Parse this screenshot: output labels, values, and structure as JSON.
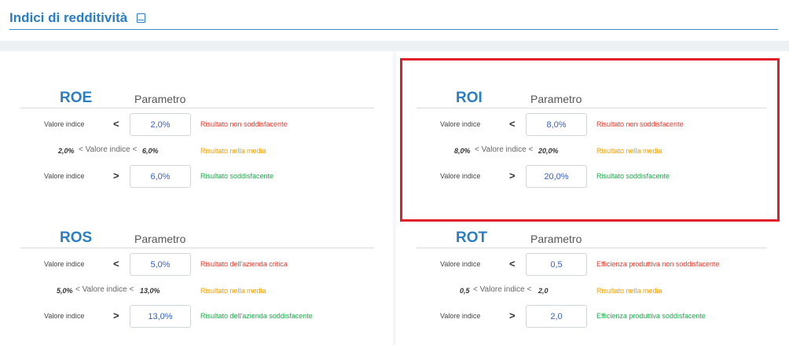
{
  "page": {
    "title": "Indici di redditività",
    "title_icon": "book-icon"
  },
  "labels": {
    "parametro": "Parametro",
    "valore_indice": "Valore indice",
    "mid_label": "< Valore indice <",
    "lt": "<",
    "gt": ">"
  },
  "colors": {
    "accent": "#2a7ec4",
    "red": "#e23b2e",
    "orange": "#f0a000",
    "green": "#1ba84a",
    "highlight": "#e01f2a"
  },
  "panels": {
    "roe": {
      "name": "ROE",
      "low": "2,0%",
      "high": "6,0%",
      "result_low": "Risultato non soddisfacente",
      "result_mid": "Risultato nella media",
      "result_high": "Risultato soddisfacente"
    },
    "roi": {
      "name": "ROI",
      "low": "8,0%",
      "high": "20,0%",
      "result_low": "Risultato non soddisfacente",
      "result_mid": "Risultato nella media",
      "result_high": "Risultato soddisfacente"
    },
    "ros": {
      "name": "ROS",
      "low": "5,0%",
      "high": "13,0%",
      "result_low": "Risultato dell'azienda critica",
      "result_mid": "Risultato nella media",
      "result_high": "Risultato dell'azienda soddisfacente"
    },
    "rot": {
      "name": "ROT",
      "low": "0,5",
      "high": "2,0",
      "result_low": "Efficienza produttiva non soddisfacente",
      "result_mid": "Risultato nella media",
      "result_high": "Efficienza produttiva soddisfacente"
    }
  }
}
